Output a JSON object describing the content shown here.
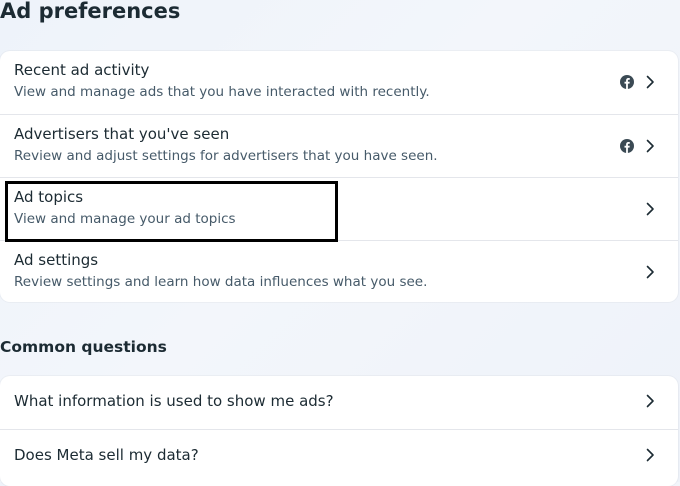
{
  "page": {
    "title": "Ad preferences"
  },
  "preferences": [
    {
      "title": "Recent ad activity",
      "description": "View and manage ads that you have interacted with recently.",
      "icon": "facebook-icon"
    },
    {
      "title": "Advertisers that you've seen",
      "description": "Review and adjust settings for advertisers that you have seen.",
      "icon": "facebook-icon"
    },
    {
      "title": "Ad topics",
      "description": "View and manage your ad topics",
      "icon": ""
    },
    {
      "title": "Ad settings",
      "description": "Review settings and learn how data influences what you see.",
      "icon": ""
    }
  ],
  "common_questions": {
    "heading": "Common questions",
    "items": [
      {
        "title": "What information is used to show me ads?"
      },
      {
        "title": "Does Meta sell my data?"
      }
    ]
  },
  "colors": {
    "highlight_border": "#000000",
    "card_bg": "#ffffff",
    "page_bg": "#eef3fa"
  }
}
